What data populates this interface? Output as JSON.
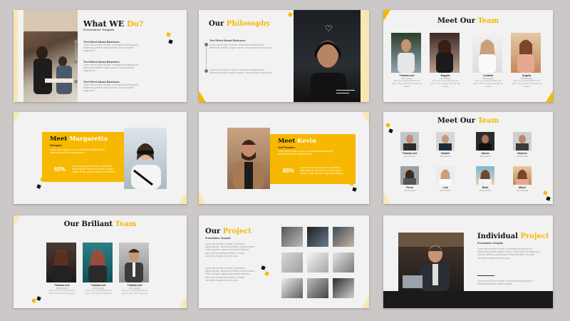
{
  "slide1": {
    "title_a": "What WE ",
    "title_b": "Do?",
    "subtitle": "Presentation Template",
    "items": [
      {
        "heading": "Text Word About Business",
        "body": "Lorem ipsum dolor sit amet, consectetur adipiscing elit. Maecenas porttitor congue massa. Fusce posuere magna sed"
      },
      {
        "heading": "Text Word About Business",
        "body": "Lorem ipsum dolor sit amet, consectetur adipiscing elit. Maecenas porttitor congue massa. Fusce posuere magna sed"
      },
      {
        "heading": "Text Word About Business",
        "body": "Lorem ipsum dolor sit amet, consectetur adipiscing elit. Maecenas porttitor congue massa. Fusce posuere magna sed"
      }
    ]
  },
  "slide2": {
    "title_a": "Our ",
    "title_b": "Philosophy",
    "heading": "Text Word About Business",
    "body1": "Lorem ipsum dolor sit amet, consectetur adipiscing elit. Maecenas porttitor congue massa. Fusce posuere magna sed",
    "body2": "Lorem ipsum dolor sit amet, consectetur adipiscing elit. Maecenas porttitor congue massa. Fusce posuere magna sed"
  },
  "slide3": {
    "title_a": "Meet Our ",
    "title_b": "Team",
    "members": [
      {
        "name": "Thomas mel",
        "role": "Job Position",
        "desc": "Here you could describe the topic of the section describe the section"
      },
      {
        "name": "Eugylia",
        "role": "Job Position",
        "desc": "Here you could describe the topic of the section describe the section"
      },
      {
        "name": "Luciana",
        "role": "Job Position",
        "desc": "Here you could describe the topic of the section describe the section"
      },
      {
        "name": "Angela",
        "role": "Job Position",
        "desc": "Here you could describe the topic of the section describe the section"
      }
    ]
  },
  "slide4": {
    "title_a": "Meet ",
    "title_b": "Margaretta",
    "role": "Designer",
    "intro": "Lorem ipsum dolor sit amet, consectetur adipiscing elit. Maecenas porttitor congue massa.",
    "percent": "65%",
    "body": "Lorem ipsum dolor sit amet, consectetur adipiscing elit. Maecenas porttitor congue massa. Fusce posuere magna sed pulvinar"
  },
  "slide5": {
    "title_a": "Meet ",
    "title_b": "Kevin",
    "role": "Job Position",
    "intro": "Lorem ipsum dolor sit amet, consectetur adipiscing elit. Maecenas porttitor congue massa.",
    "percent": "85%",
    "body": "Lorem ipsum dolor sit amet, consectetur adipiscing elit. Maecenas porttitor congue massa. Fusce posuere magna sed pulvinar"
  },
  "slide6": {
    "title_a": "Meet Our ",
    "title_b": "Team",
    "row1": [
      {
        "name": "Thomas mel",
        "role": "Job Position"
      },
      {
        "name": "Gabriel",
        "role": "Job Position"
      },
      {
        "name": "James",
        "role": "Job Position"
      },
      {
        "name": "Homero",
        "role": "Job Position"
      }
    ],
    "row2": [
      {
        "name": "Ferna",
        "role": "Job Position"
      },
      {
        "name": "Lisa",
        "role": "Job Position"
      },
      {
        "name": "Bella",
        "role": "Job Position"
      },
      {
        "name": "Mitzel",
        "role": "Job Position"
      }
    ]
  },
  "slide7": {
    "title_a": "Our Briliant ",
    "title_b": "Team",
    "members": [
      {
        "name": "Thomas mel",
        "role": "Job Position",
        "desc": "Here you could describe the topic of the section describe"
      },
      {
        "name": "Thomas mel",
        "role": "Job Position",
        "desc": "Here you could describe the topic of the section describe"
      },
      {
        "name": "Thomas mel",
        "role": "Job Position",
        "desc": "Here you could describe the topic of the section describe"
      }
    ]
  },
  "slide8": {
    "title_a": "Our ",
    "title_b": "Project",
    "subtitle": "Presentation Template",
    "body1": "Lorem ipsum dolor sit amet, consectetur adipiscing elit. Maecenas porttitor congue massa. Fusce posuere magna sed pulvinar ultricies, purus lectus malesuada libero, sit amet commodo magna eros quis urna.",
    "body2": "Lorem ipsum dolor sit amet, consectetur adipiscing elit. Maecenas porttitor congue massa. Fusce posuere magna sed pulvinar ultricies, purus lectus malesuada libero, sit amet commodo magna eros quis urna."
  },
  "slide9": {
    "title_a": "Individual ",
    "title_b": "Project",
    "subtitle": "Presentation Template",
    "body1": "Lorem ipsum dolor sit amet, consectetur adipiscing elit. Maecenas porttitor congue massa. Fusce posuere magna sed pulvinar ultricies, purus lectus malesuada libero, sit amet commodo magna eros quis urna.",
    "body2": "Lorem ipsum dolor sit amet, consectetur adipiscing elit. Maecenas porttitor congue massa."
  },
  "colors": {
    "accent": "#f6b800",
    "dark": "#1a1a1a",
    "cream": "#f9e7b3"
  }
}
